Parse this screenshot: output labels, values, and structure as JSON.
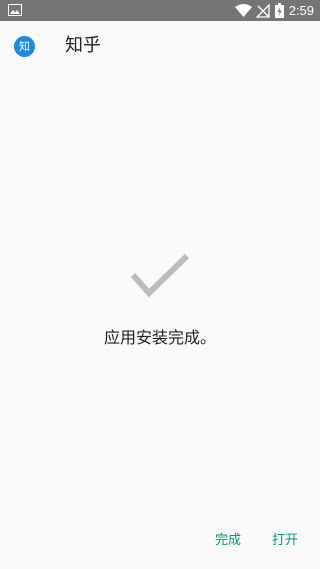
{
  "status_bar": {
    "time": "2:59",
    "icons": [
      "gallery-icon",
      "wifi-icon",
      "no-signal-icon",
      "battery-charging-icon"
    ]
  },
  "header": {
    "app_icon_text": "知",
    "app_name": "知乎"
  },
  "main": {
    "icon": "check-icon",
    "message": "应用安装完成。"
  },
  "actions": {
    "done_label": "完成",
    "open_label": "打开"
  },
  "colors": {
    "status_bar_bg": "#757575",
    "background": "#fafafa",
    "app_icon_bg": "#1e88e5",
    "check_icon": "#bdbdbd",
    "accent": "#009688",
    "text": "#212121"
  }
}
